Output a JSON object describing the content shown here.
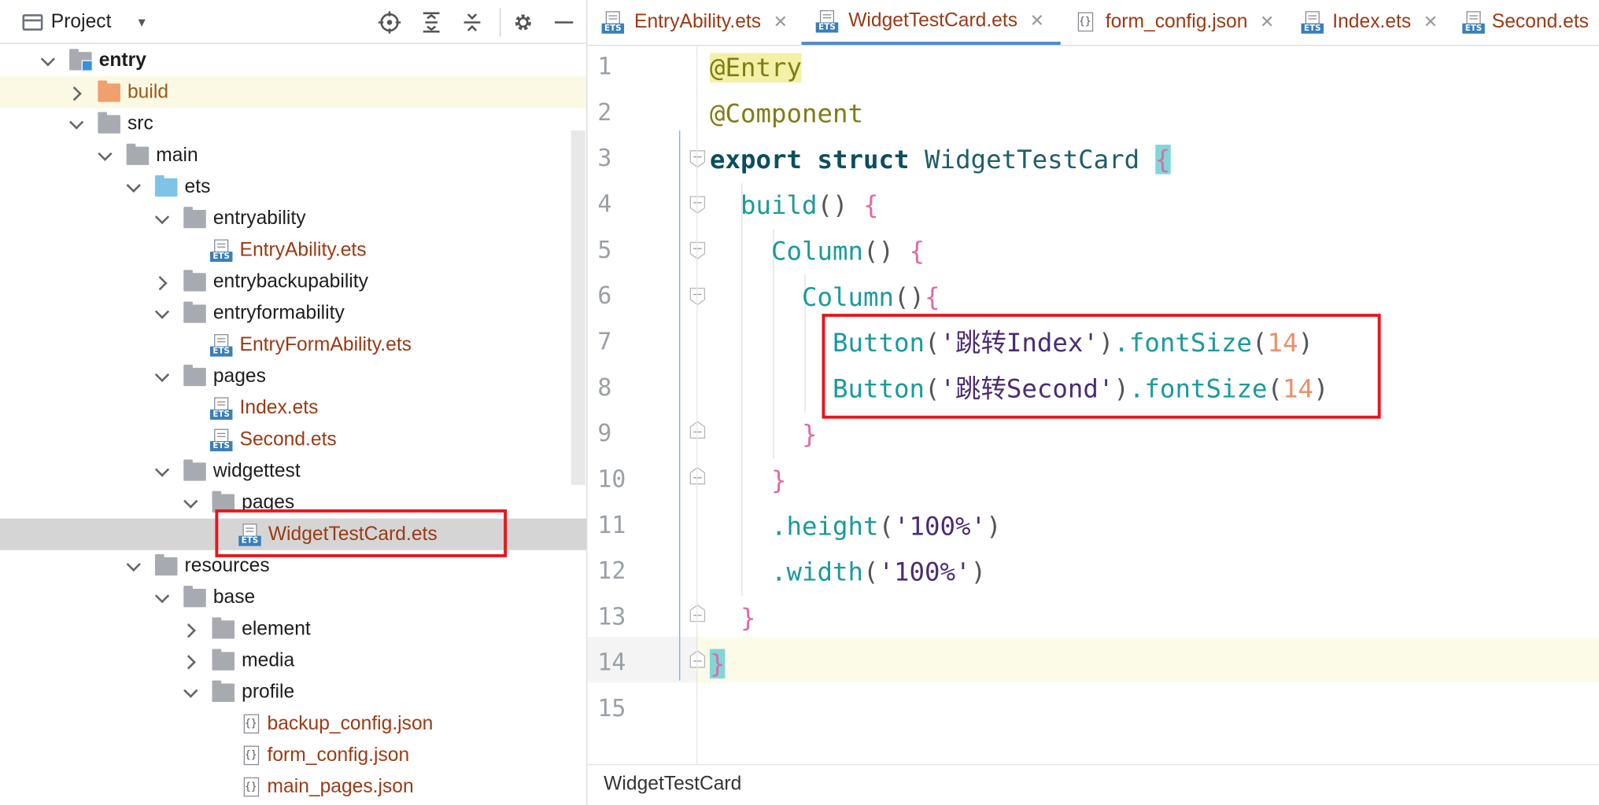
{
  "project_panel": {
    "title": "Project",
    "tree": [
      {
        "label": "entry",
        "depth": 0,
        "expanded": true,
        "kind": "module"
      },
      {
        "label": "build",
        "depth": 1,
        "expanded": false,
        "kind": "folder-orange"
      },
      {
        "label": "src",
        "depth": 1,
        "expanded": true,
        "kind": "folder"
      },
      {
        "label": "main",
        "depth": 2,
        "expanded": true,
        "kind": "folder"
      },
      {
        "label": "ets",
        "depth": 3,
        "expanded": true,
        "kind": "folder-blue"
      },
      {
        "label": "entryability",
        "depth": 4,
        "expanded": true,
        "kind": "folder"
      },
      {
        "label": "EntryAbility.ets",
        "depth": 5,
        "kind": "ets"
      },
      {
        "label": "entrybackupability",
        "depth": 4,
        "expanded": false,
        "kind": "folder"
      },
      {
        "label": "entryformability",
        "depth": 4,
        "expanded": true,
        "kind": "folder"
      },
      {
        "label": "EntryFormAbility.ets",
        "depth": 5,
        "kind": "ets"
      },
      {
        "label": "pages",
        "depth": 4,
        "expanded": true,
        "kind": "folder"
      },
      {
        "label": "Index.ets",
        "depth": 5,
        "kind": "ets"
      },
      {
        "label": "Second.ets",
        "depth": 5,
        "kind": "ets"
      },
      {
        "label": "widgettest",
        "depth": 4,
        "expanded": true,
        "kind": "folder"
      },
      {
        "label": "pages",
        "depth": 5,
        "expanded": true,
        "kind": "folder"
      },
      {
        "label": "WidgetTestCard.ets",
        "depth": 6,
        "kind": "ets",
        "selected": true
      },
      {
        "label": "resources",
        "depth": 3,
        "expanded": true,
        "kind": "folder"
      },
      {
        "label": "base",
        "depth": 4,
        "expanded": true,
        "kind": "folder"
      },
      {
        "label": "element",
        "depth": 5,
        "expanded": false,
        "kind": "folder"
      },
      {
        "label": "media",
        "depth": 5,
        "expanded": false,
        "kind": "folder"
      },
      {
        "label": "profile",
        "depth": 5,
        "expanded": true,
        "kind": "folder"
      },
      {
        "label": "backup_config.json",
        "depth": 6,
        "kind": "json"
      },
      {
        "label": "form_config.json",
        "depth": 6,
        "kind": "json"
      },
      {
        "label": "main_pages.json",
        "depth": 6,
        "kind": "json"
      }
    ]
  },
  "editor": {
    "tabs": [
      {
        "label": "EntryAbility.ets",
        "kind": "ets",
        "active": false
      },
      {
        "label": "WidgetTestCard.ets",
        "kind": "ets",
        "active": true
      },
      {
        "label": "form_config.json",
        "kind": "json",
        "active": false
      },
      {
        "label": "Index.ets",
        "kind": "ets",
        "active": false
      },
      {
        "label": "Second.ets",
        "kind": "ets",
        "active": false
      }
    ],
    "line_numbers": [
      "1",
      "2",
      "3",
      "4",
      "5",
      "6",
      "7",
      "8",
      "9",
      "10",
      "11",
      "12",
      "13",
      "14",
      "15"
    ],
    "code_lines": [
      "@Entry",
      "@Component",
      "export struct WidgetTestCard {",
      "  build() {",
      "    Column() {",
      "      Column(){",
      "        Button('跳转Index').fontSize(14)",
      "        Button('跳转Second').fontSize(14)",
      "      }",
      "    }",
      "    .height('100%')",
      "    .width('100%')",
      "  }",
      "}",
      ""
    ],
    "breadcrumb": "WidgetTestCard"
  },
  "colors": {
    "annotation_highlight": "#e8161b",
    "file_name": "#9b3a14",
    "active_tab_underline": "#4a87d6"
  }
}
